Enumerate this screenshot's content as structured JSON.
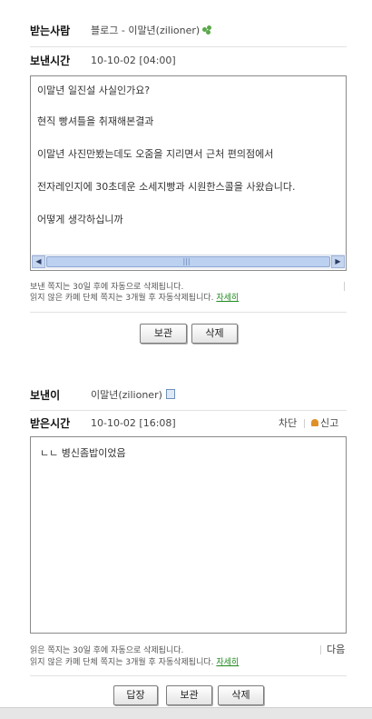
{
  "sent": {
    "to_label": "받는사람",
    "to_value": "블로그 - 이말년(zilioner)",
    "time_label": "보낸시간",
    "time_value": "10-10-02 [04:00]",
    "lines": [
      "이말년 일진설 사실인가요?",
      "현직 빵셔틀을 취재해본결과",
      "이말년 사진만봤는데도 오줌을 지리면서 근처 편의점에서",
      "전자레인지에 30초데운 소세지빵과 시원한스콜을 사왔습니다.",
      "어떻게 생각하십니까"
    ],
    "scroll_grip": "|||",
    "note1": "보낸 쪽지는 30일 후에 자동으로 삭제됩니다.",
    "note2": "읽지 않은 카페 단체 쪽지는 3개월 후 자동삭제됩니다.",
    "more_link": "자세히",
    "btn_keep": "보관",
    "btn_delete": "삭제"
  },
  "received": {
    "from_label": "보낸이",
    "from_value": "이말년(zilioner)",
    "time_label": "받은시간",
    "time_value": "10-10-02 [16:08]",
    "block_link": "차단",
    "report_link": "신고",
    "lines": [
      "ㄴㄴ 병신좀밥이었음"
    ],
    "note1": "읽은 쪽지는 30일 후에 자동으로 삭제됩니다.",
    "note2": "읽지 않은 카페 단체 쪽지는 3개월 후 자동삭제됩니다.",
    "more_link": "자세히",
    "next_link": "다음",
    "btn_reply": "답장",
    "btn_keep": "보관",
    "btn_delete": "삭제"
  }
}
